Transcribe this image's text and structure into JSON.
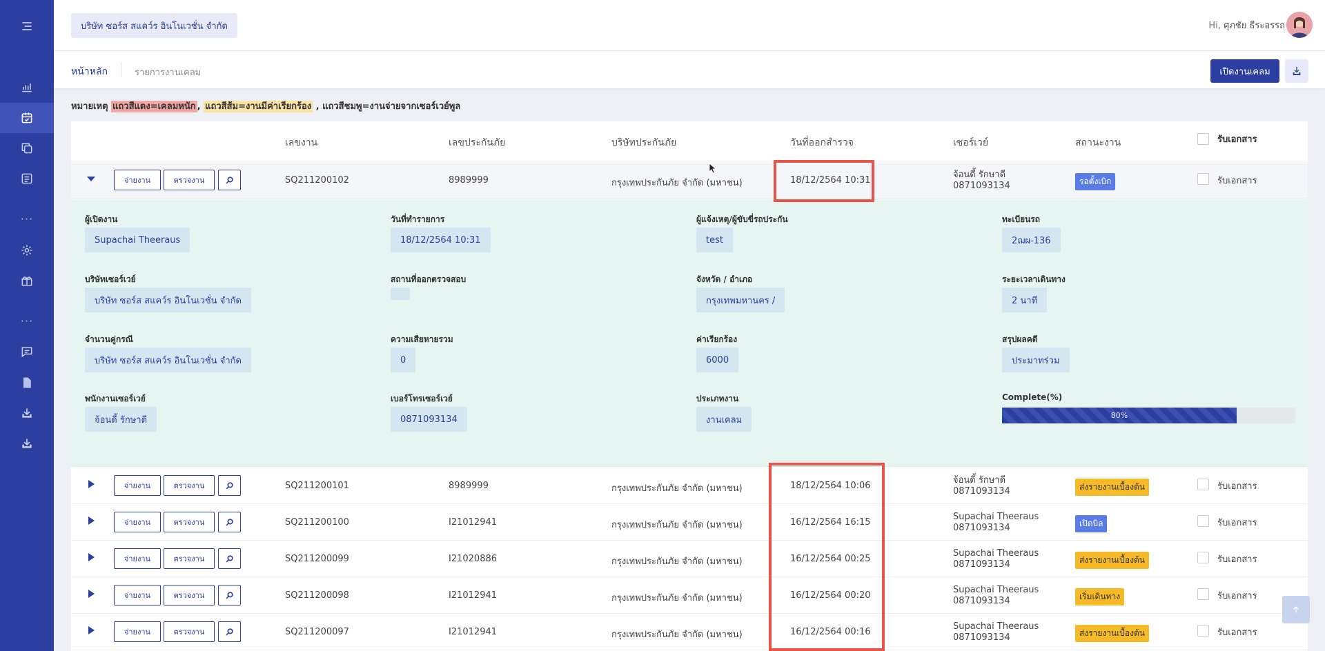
{
  "header": {
    "company": "บริษัท ซอร์ส สแคว์ร อินโนเวชั่น จำกัด",
    "greeting_prefix": "Hi,",
    "user_name": "ศุภชัย ธีระอรรถ"
  },
  "breadcrumb": {
    "home": "หน้าหลัก",
    "page": "รายการงานเคลม"
  },
  "toolbar": {
    "open_claim_label": "เปิดงานเคลม"
  },
  "note": {
    "prefix": "หมายเหตุ",
    "red": "แถวสีแดง=เคลมหนัก",
    "sep1": ",",
    "orange": "แถวสีส้ม=งานมีค่าเรียกร้อง",
    "rest": ", แถวสีชมพู=งานจ่ายจากเซอร์เวย์พูล"
  },
  "table": {
    "columns": {
      "job_no": "เลขงาน",
      "policy_no": "เลขประกันภัย",
      "insurer": "บริษัทประกันภัย",
      "survey_date": "วันที่ออกสำรวจ",
      "surveyor": "เซอร์เวย์",
      "status": "สถานะงาน",
      "receive_doc": "รับเอกสาร"
    },
    "button_pay": "จ่ายงาน",
    "button_check": "ตรวจงาน",
    "rows": [
      {
        "job_no": "SQ211200102",
        "policy_no": "8989999",
        "insurer": "กรุงเทพประกันภัย จำกัด (มหาชน)",
        "survey_date": "18/12/2564 10:31",
        "surveyor_name": "จ้อนดี้ รักษาดี",
        "surveyor_phone": "0871093134",
        "status": "รอตั้งเบิก",
        "status_color": "#5b7ce6",
        "receive_doc": "รับเอกสาร"
      },
      {
        "job_no": "SQ211200101",
        "policy_no": "8989999",
        "insurer": "กรุงเทพประกันภัย จำกัด (มหาชน)",
        "survey_date": "18/12/2564 10:06",
        "surveyor_name": "จ้อนดี้ รักษาดี",
        "surveyor_phone": "0871093134",
        "status": "ส่งรายงานเบื้องต้น",
        "status_color": "#f6b928",
        "receive_doc": "รับเอกสาร"
      },
      {
        "job_no": "SQ211200100",
        "policy_no": "I21012941",
        "insurer": "กรุงเทพประกันภัย จำกัด (มหาชน)",
        "survey_date": "16/12/2564 16:15",
        "surveyor_name": "Supachai Theeraus",
        "surveyor_phone": "0871093134",
        "status": "เปิดบิล",
        "status_color": "#5b7ce6",
        "receive_doc": "รับเอกสาร"
      },
      {
        "job_no": "SQ211200099",
        "policy_no": "I21020886",
        "insurer": "กรุงเทพประกันภัย จำกัด (มหาชน)",
        "survey_date": "16/12/2564 00:25",
        "surveyor_name": "Supachai Theeraus",
        "surveyor_phone": "0871093134",
        "status": "ส่งรายงานเบื้องต้น",
        "status_color": "#f6b928",
        "receive_doc": "รับเอกสาร"
      },
      {
        "job_no": "SQ211200098",
        "policy_no": "I21012941",
        "insurer": "กรุงเทพประกันภัย จำกัด (มหาชน)",
        "survey_date": "16/12/2564 00:20",
        "surveyor_name": "Supachai Theeraus",
        "surveyor_phone": "0871093134",
        "status": "เริ่มเดินทาง",
        "status_color": "#f6b928",
        "receive_doc": "รับเอกสาร"
      },
      {
        "job_no": "SQ211200097",
        "policy_no": "I21012941",
        "insurer": "กรุงเทพประกันภัย จำกัด (มหาชน)",
        "survey_date": "16/12/2564 00:16",
        "surveyor_name": "Supachai Theeraus",
        "surveyor_phone": "0871093134",
        "status": "ส่งรายงานเบื้องต้น",
        "status_color": "#f6b928",
        "receive_doc": "รับเอกสาร"
      }
    ]
  },
  "detail": {
    "opener_label": "ผู้เปิดงาน",
    "opener": "Supachai Theeraus",
    "list_date_label": "วันที่ทำรายการ",
    "list_date": "18/12/2564 10:31",
    "notifier_label": "ผู้แจ้งเหตุ/ผู้ขับขี่รถประกัน",
    "notifier": "test",
    "plate_label": "ทะเบียนรถ",
    "plate": "2ฌผ-136",
    "survey_company_label": "บริษัทเซอร์เวย์",
    "survey_company": "บริษัท ซอร์ส สแคว์ร อินโนเวชั่น จำกัด",
    "location_label": "สถานที่ออกตรวจสอบ",
    "location": "",
    "province_label": "จังหวัด / อำเภอ",
    "province": "กรุงเทพมหานคร /",
    "travel_time_label": "ระยะเวลาเดินทาง",
    "travel_time": "2 นาที",
    "counterpart_label": "จำนวนคู่กรณี",
    "counterpart": "บริษัท ซอร์ส สแคว์ร อินโนเวชั่น จำกัด",
    "damage_label": "ความเสียหายรวม",
    "damage": "0",
    "claim_amount_label": "ค่าเรียกร้อง",
    "claim_amount": "6000",
    "summary_label": "สรุปผลคดี",
    "summary": "ประมาทร่วม",
    "staff_label": "พนักงานเซอร์เวย์",
    "staff": "จ้อนดี้ รักษาดี",
    "phone_label": "เบอร์โทรเซอร์เวย์",
    "phone": "0871093134",
    "job_type_label": "ประเภทงาน",
    "job_type": "งานเคลม",
    "complete_label": "Complete(%)",
    "complete_text": "80%",
    "complete_value": 80
  },
  "colors": {
    "sidebar": "#2c3e9f",
    "accent": "#2c3e9f",
    "detail_bg": "#e6f5f2",
    "highlight": "#e8554a"
  }
}
